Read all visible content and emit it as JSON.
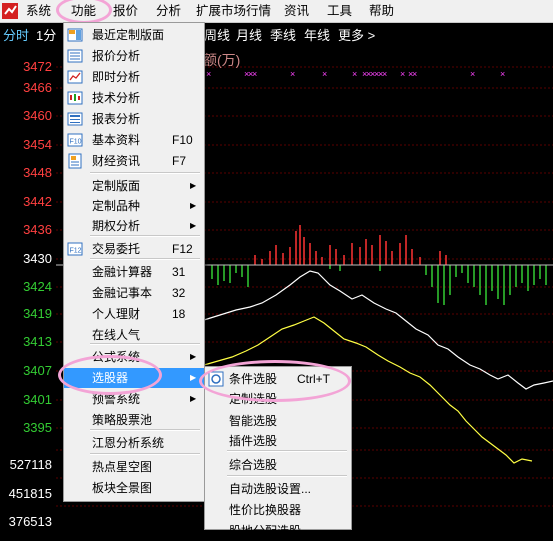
{
  "menubar": {
    "items": [
      "系统",
      "功能",
      "报价",
      "分析",
      "扩展市场行情",
      "资讯",
      "工具",
      "帮助"
    ],
    "icon": "app-logo-icon"
  },
  "periods": [
    "分时",
    "1分",
    "周线",
    "月线",
    "季线",
    "年线",
    "更多 >"
  ],
  "chart": {
    "price_ticks": [
      {
        "v": "3472",
        "c": "#ff4040"
      },
      {
        "v": "3466",
        "c": "#ff4040"
      },
      {
        "v": "3460",
        "c": "#ff4040"
      },
      {
        "v": "3454",
        "c": "#ff4040"
      },
      {
        "v": "3448",
        "c": "#ff4040"
      },
      {
        "v": "3442",
        "c": "#ff4040"
      },
      {
        "v": "3436",
        "c": "#ff4040"
      },
      {
        "v": "3430",
        "c": "#ffffff"
      },
      {
        "v": "3424",
        "c": "#33cc33"
      },
      {
        "v": "3419",
        "c": "#33cc33"
      },
      {
        "v": "3413",
        "c": "#33cc33"
      },
      {
        "v": "3407",
        "c": "#33cc33"
      },
      {
        "v": "3401",
        "c": "#33cc33"
      },
      {
        "v": "3395",
        "c": "#33cc33"
      }
    ],
    "volume_ticks": [
      "527118",
      "451815",
      "376513"
    ],
    "header_fragment": "额(万)",
    "accent_red": "#ff3333",
    "accent_green": "#33cc33",
    "grid_color": "#800000"
  },
  "menu1": {
    "items": [
      {
        "label": "最近定制版面",
        "shortcut": "",
        "icon": "layout-icon",
        "submenu": false
      },
      {
        "label": "报价分析",
        "shortcut": "",
        "icon": "quote-icon",
        "submenu": false
      },
      {
        "label": "即时分析",
        "shortcut": "",
        "icon": "line-chart-icon",
        "submenu": false
      },
      {
        "label": "技术分析",
        "shortcut": "",
        "icon": "candlestick-icon",
        "submenu": false
      },
      {
        "label": "报表分析",
        "shortcut": "",
        "icon": "report-icon",
        "submenu": false
      },
      {
        "label": "基本资料",
        "shortcut": "F10",
        "icon": "f10-icon",
        "submenu": false
      },
      {
        "label": "财经资讯",
        "shortcut": "F7",
        "icon": "news-icon",
        "submenu": false
      },
      {
        "label": "定制版面",
        "shortcut": "",
        "icon": "",
        "submenu": true
      },
      {
        "label": "定制品种",
        "shortcut": "",
        "icon": "",
        "submenu": true
      },
      {
        "label": "期权分析",
        "shortcut": "",
        "icon": "",
        "submenu": true
      },
      {
        "label": "交易委托",
        "shortcut": "F12",
        "icon": "f12-icon",
        "submenu": false
      },
      {
        "label": "金融计算器",
        "shortcut": "31",
        "icon": "",
        "submenu": false
      },
      {
        "label": "金融记事本",
        "shortcut": "32",
        "icon": "",
        "submenu": false
      },
      {
        "label": "个人理财",
        "shortcut": "18",
        "icon": "",
        "submenu": false
      },
      {
        "label": "在线人气",
        "shortcut": "",
        "icon": "",
        "submenu": false
      },
      {
        "label": "公式系统",
        "shortcut": "",
        "icon": "",
        "submenu": true
      },
      {
        "label": "选股器",
        "shortcut": "",
        "icon": "",
        "submenu": true
      },
      {
        "label": "预警系统",
        "shortcut": "",
        "icon": "",
        "submenu": true
      },
      {
        "label": "策略股票池",
        "shortcut": "",
        "icon": "",
        "submenu": false
      },
      {
        "label": "江恩分析系统",
        "shortcut": "",
        "icon": "",
        "submenu": false
      },
      {
        "label": "热点星空图",
        "shortcut": "",
        "icon": "",
        "submenu": false
      },
      {
        "label": "板块全景图",
        "shortcut": "",
        "icon": "",
        "submenu": false
      }
    ],
    "selected_index": 16
  },
  "menu2": {
    "items": [
      {
        "label": "条件选股",
        "shortcut": "Ctrl+T",
        "icon": "filter-icon"
      },
      {
        "label": "定制选股",
        "shortcut": "",
        "icon": ""
      },
      {
        "label": "智能选股",
        "shortcut": "",
        "icon": ""
      },
      {
        "label": "插件选股",
        "shortcut": "",
        "icon": ""
      },
      {
        "label": "综合选股",
        "shortcut": "",
        "icon": ""
      },
      {
        "label": "自动选股设置...",
        "shortcut": "",
        "icon": ""
      },
      {
        "label": "性价比换股器",
        "shortcut": "",
        "icon": ""
      },
      {
        "label": "股地分配选股",
        "shortcut": "",
        "icon": ""
      }
    ]
  }
}
